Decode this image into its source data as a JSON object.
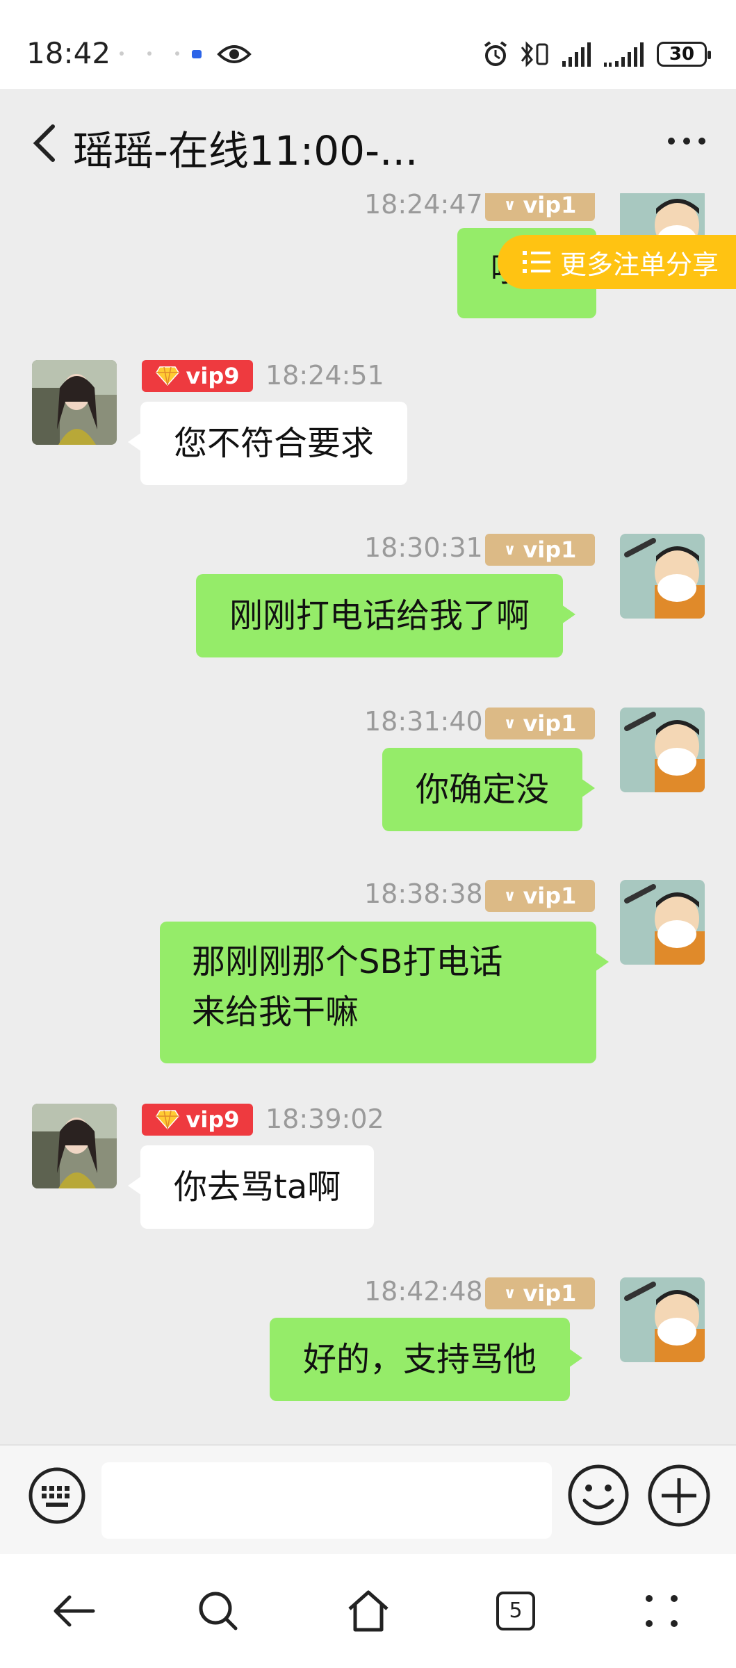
{
  "status_bar": {
    "time": "18:42",
    "battery": "30",
    "icons": [
      "eye-icon",
      "alarm-icon",
      "bluetooth-icon",
      "vibrate-icon",
      "signal-icon",
      "signal-icon",
      "battery-icon"
    ]
  },
  "header": {
    "title": "瑶瑶-在线11:00-...",
    "back_icon": "chevron-left-icon",
    "more_icon": "more-dots-icon"
  },
  "share_button": {
    "label": "更多注单分享",
    "color": "#ffc312"
  },
  "messages": [
    {
      "side": "right",
      "time": "18:24:47",
      "vip": "vip1",
      "text": "哦",
      "partial": true
    },
    {
      "side": "left",
      "time": "18:24:51",
      "vip": "vip9",
      "text": "您不符合要求"
    },
    {
      "side": "right",
      "time": "18:30:31",
      "vip": "vip1",
      "text": "刚刚打电话给我了啊"
    },
    {
      "side": "right",
      "time": "18:31:40",
      "vip": "vip1",
      "text": "你确定没"
    },
    {
      "side": "right",
      "time": "18:38:38",
      "vip": "vip1",
      "text_lines": [
        "那刚刚那个SB打电话",
        "来给我干嘛"
      ]
    },
    {
      "side": "left",
      "time": "18:39:02",
      "vip": "vip9",
      "text": "你去骂ta啊"
    },
    {
      "side": "right",
      "time": "18:42:48",
      "vip": "vip1",
      "text": "好的，支持骂他"
    }
  ],
  "input_bar": {
    "keyboard_icon": "keyboard-icon",
    "input_value": "",
    "emoji_icon": "smiley-icon",
    "plus_icon": "plus-circle-icon"
  },
  "nav_bar": {
    "tab_count": "5",
    "icons": [
      "back-arrow-icon",
      "search-icon",
      "home-icon",
      "tabs-icon",
      "menu-dots-icon"
    ]
  },
  "colors": {
    "green_bubble": "#95ec69",
    "white_bubble": "#ffffff",
    "background": "#ededed",
    "vip1_badge": "#dcba86",
    "vip9_badge": "#ee3a3f"
  }
}
